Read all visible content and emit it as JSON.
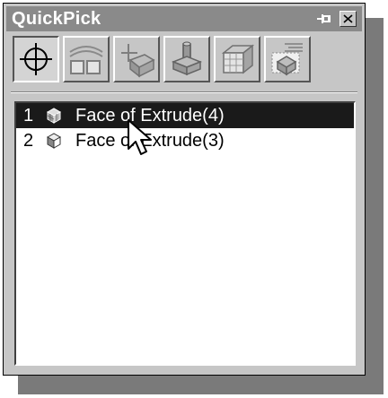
{
  "window": {
    "title": "QuickPick"
  },
  "titlebar_buttons": {
    "pin_icon": "pin-icon",
    "close_icon": "close-icon"
  },
  "toolbar": {
    "tools": [
      {
        "icon": "crosshair-filter-icon",
        "state": "pressed"
      },
      {
        "icon": "curve-edges-filter-icon",
        "state": "normal"
      },
      {
        "icon": "axis-solid-filter-icon",
        "state": "normal"
      },
      {
        "icon": "point-solid-filter-icon",
        "state": "normal"
      },
      {
        "icon": "solid-box-filter-icon",
        "state": "normal"
      },
      {
        "icon": "feature-list-filter-icon",
        "state": "normal"
      }
    ]
  },
  "list": {
    "items": [
      {
        "index": "1",
        "label": "Face of Extrude(4)",
        "selected": true,
        "icon": "face-icon"
      },
      {
        "index": "2",
        "label": "Face of Extrude(3)",
        "selected": false,
        "icon": "face-icon"
      }
    ]
  },
  "colors": {
    "titlebar": "#8a8a8a",
    "selection": "#1a1a1a",
    "panel": "#c6c6c6"
  }
}
